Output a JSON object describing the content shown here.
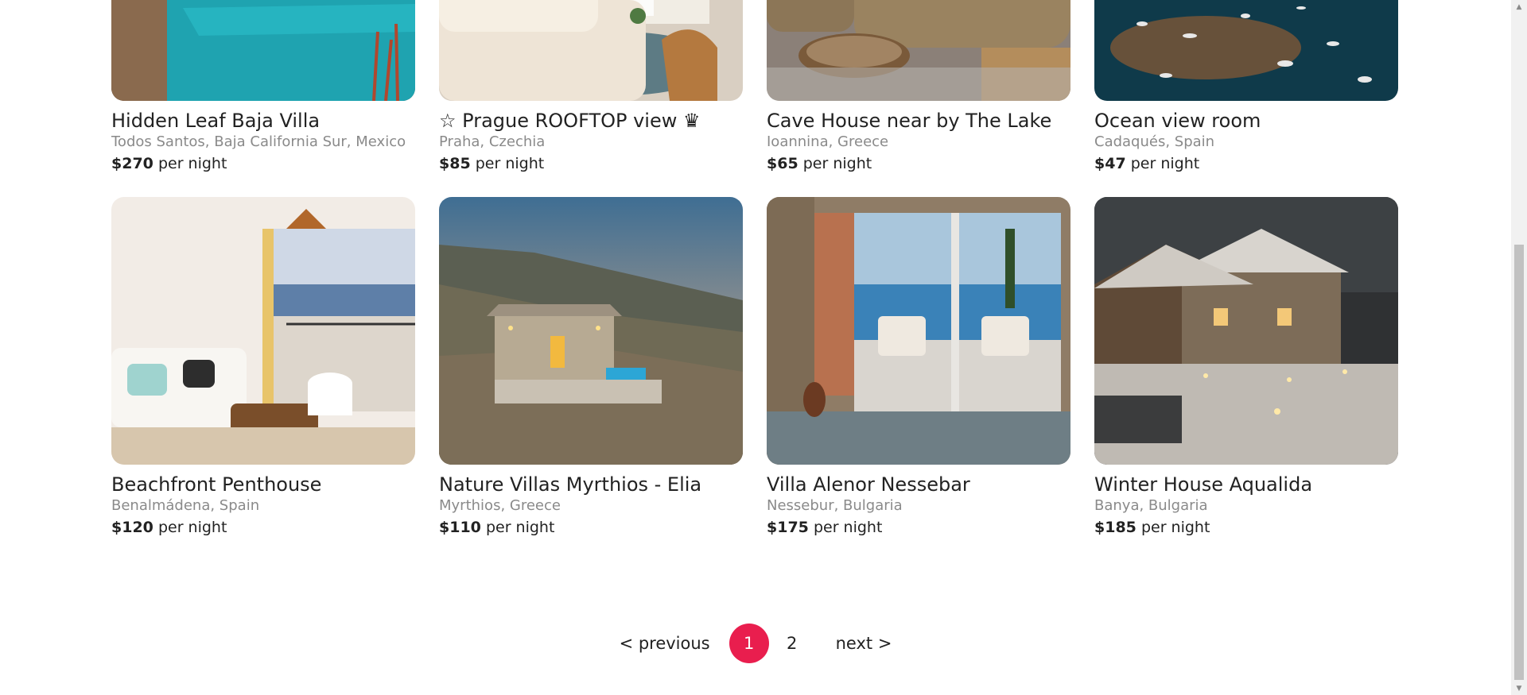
{
  "listings_row1": [
    {
      "title": "Hidden Leaf Baja Villa",
      "location": "Todos Santos, Baja California Sur, Mexico",
      "price": "$270",
      "per": "per night",
      "image": "pool-villa-photo"
    },
    {
      "title": "☆ Prague ROOFTOP view ♛",
      "location": "Praha, Czechia",
      "price": "$85",
      "per": "per night",
      "image": "living-room-photo"
    },
    {
      "title": "Cave House near by The Lake",
      "location": "Ioannina, Greece",
      "price": "$65",
      "per": "per night",
      "image": "vintage-sofa-photo"
    },
    {
      "title": "Ocean view room",
      "location": "Cadaqués, Spain",
      "price": "$47",
      "per": "per night",
      "image": "harbor-boats-photo"
    }
  ],
  "listings_row2": [
    {
      "title": "Beachfront Penthouse",
      "location": "Benalmádena, Spain",
      "price": "$120",
      "per": "per night",
      "image": "penthouse-living-photo"
    },
    {
      "title": "Nature Villas Myrthios - Elia",
      "location": "Myrthios, Greece",
      "price": "$110",
      "per": "per night",
      "image": "stone-villa-hillside-photo"
    },
    {
      "title": "Villa Alenor Nessebar",
      "location": "Nessebur, Bulgaria",
      "price": "$175",
      "per": "per night",
      "image": "sea-view-balcony-photo"
    },
    {
      "title": "Winter House Aqualida",
      "location": "Banya, Bulgaria",
      "price": "$185",
      "per": "per night",
      "image": "snowy-chalet-photo"
    }
  ],
  "pagination": {
    "previous": "< previous",
    "pages": [
      "1",
      "2"
    ],
    "current": "1",
    "next": "next >"
  },
  "colors": {
    "accent": "#e91e4e",
    "text": "#222222",
    "muted": "#8a8a8a"
  }
}
